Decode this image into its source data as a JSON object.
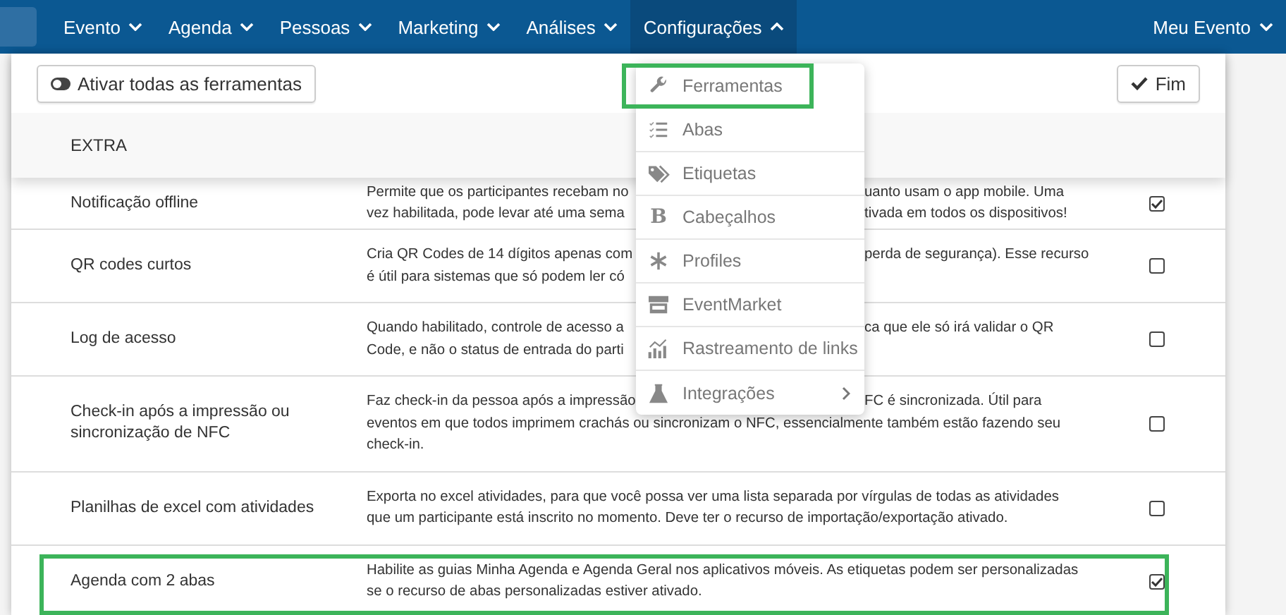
{
  "nav": {
    "items": [
      {
        "label": "Evento",
        "open": false
      },
      {
        "label": "Agenda",
        "open": false
      },
      {
        "label": "Pessoas",
        "open": false
      },
      {
        "label": "Marketing",
        "open": false
      },
      {
        "label": "Análises",
        "open": false
      },
      {
        "label": "Configurações",
        "open": true
      }
    ],
    "account": "Meu Evento"
  },
  "toolbar": {
    "toggle_all": "Ativar todas as ferramentas",
    "done": "Fim"
  },
  "section": "EXTRA",
  "rows": [
    {
      "name": "Notificação offline",
      "checked": true,
      "highlighted": false,
      "lines": [
        {
          "left": "Permite que os participantes recebam no",
          "right": "uanto usam o app mobile. Uma"
        },
        {
          "left": "vez habilitada, pode levar até uma sema",
          "right": "tivada em todos os dispositivos!"
        }
      ]
    },
    {
      "name": "QR codes curtos",
      "checked": false,
      "highlighted": false,
      "lines": [
        {
          "left": "Cria QR Codes de 14 dígitos apenas com",
          "right": "perda de segurança). Esse recurso"
        },
        {
          "left": "é útil para sistemas que só podem ler có"
        }
      ]
    },
    {
      "name": "Log de acesso",
      "checked": false,
      "highlighted": false,
      "lines": [
        {
          "left": "Quando habilitado, controle de acesso a",
          "right": "ca que ele só irá validar o QR"
        },
        {
          "left": "Code, e não o status de entrada do parti"
        }
      ]
    },
    {
      "name": "Check-in após a impressão ou sincronização de NFC",
      "checked": false,
      "highlighted": false,
      "lines": [
        {
          "left": "Faz check-in da pessoa após a impressão",
          "right": "FC é sincronizada. Útil para"
        },
        {
          "left": "eventos em que todos imprimem crachás ou sincronizam o NFC, essencialmente também estão fazendo seu"
        },
        {
          "left": "check-in."
        }
      ]
    },
    {
      "name": "Planilhas de excel com atividades",
      "checked": false,
      "highlighted": false,
      "lines": [
        {
          "left": "Exporta no excel atividades, para que você possa ver uma lista separada por vírgulas de todas as atividades"
        },
        {
          "left": "que um participante está inscrito no momento. Deve ter o recurso de importação/exportação ativado."
        }
      ]
    },
    {
      "name": "Agenda com 2 abas",
      "checked": true,
      "highlighted": true,
      "lines": [
        {
          "left": "Habilite as guias Minha Agenda e Agenda Geral nos aplicativos móveis. As etiquetas podem ser personalizadas"
        },
        {
          "left": "se o recurso de abas personalizadas estiver ativado."
        }
      ]
    }
  ],
  "menu": [
    {
      "label": "Ferramentas",
      "kind": "wrench",
      "highlighted": true,
      "submenu": false
    },
    {
      "label": "Abas",
      "kind": "checklist",
      "highlighted": false,
      "submenu": false
    },
    {
      "label": "Etiquetas",
      "kind": "tag",
      "highlighted": false,
      "submenu": false
    },
    {
      "label": "Cabeçalhos",
      "kind": "char",
      "icon_char": "B",
      "highlighted": false,
      "submenu": false
    },
    {
      "label": "Profiles",
      "kind": "asterisk",
      "highlighted": false,
      "submenu": false
    },
    {
      "label": "EventMarket",
      "kind": "store",
      "highlighted": false,
      "submenu": false
    },
    {
      "label": "Rastreamento de links",
      "kind": "chart",
      "highlighted": false,
      "submenu": false
    },
    {
      "label": "Integrações",
      "kind": "flask",
      "highlighted": false,
      "submenu": true
    }
  ]
}
